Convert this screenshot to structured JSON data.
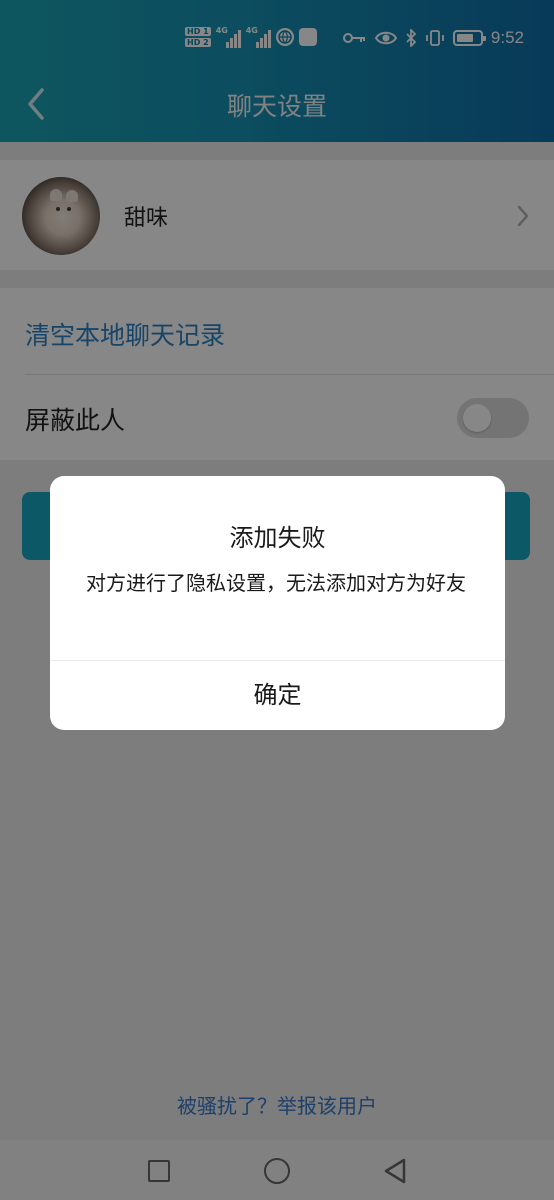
{
  "status_bar": {
    "sim1_badge": "HD 1",
    "sim2_badge": "HD 2",
    "network1": "4G",
    "network2": "4G",
    "time": "9:52",
    "icons": [
      "globe-icon",
      "app-badge-icon",
      "key-icon",
      "eye-icon",
      "bluetooth-icon",
      "vibrate-icon",
      "battery-icon"
    ]
  },
  "header": {
    "title": "聊天设置",
    "back_icon": "chevron-left-icon",
    "colors": {
      "gradient_start": "#1ba3b4",
      "gradient_end": "#0f6ea8"
    }
  },
  "profile": {
    "name": "甜味",
    "avatar": "cat-avatar",
    "chevron_icon": "chevron-right-icon"
  },
  "settings": {
    "clear_history_label": "清空本地聊天记录",
    "block_label": "屏蔽此人",
    "block_enabled": false,
    "accent_color": "#2d82c4"
  },
  "footer": {
    "report_link": "被骚扰了？举报该用户"
  },
  "nav": {
    "icons": [
      "recents-square-icon",
      "home-circle-icon",
      "back-triangle-icon"
    ]
  },
  "dialog": {
    "title": "添加失败",
    "message": "对方进行了隐私设置，无法添加对方为好友",
    "confirm_label": "确定"
  }
}
